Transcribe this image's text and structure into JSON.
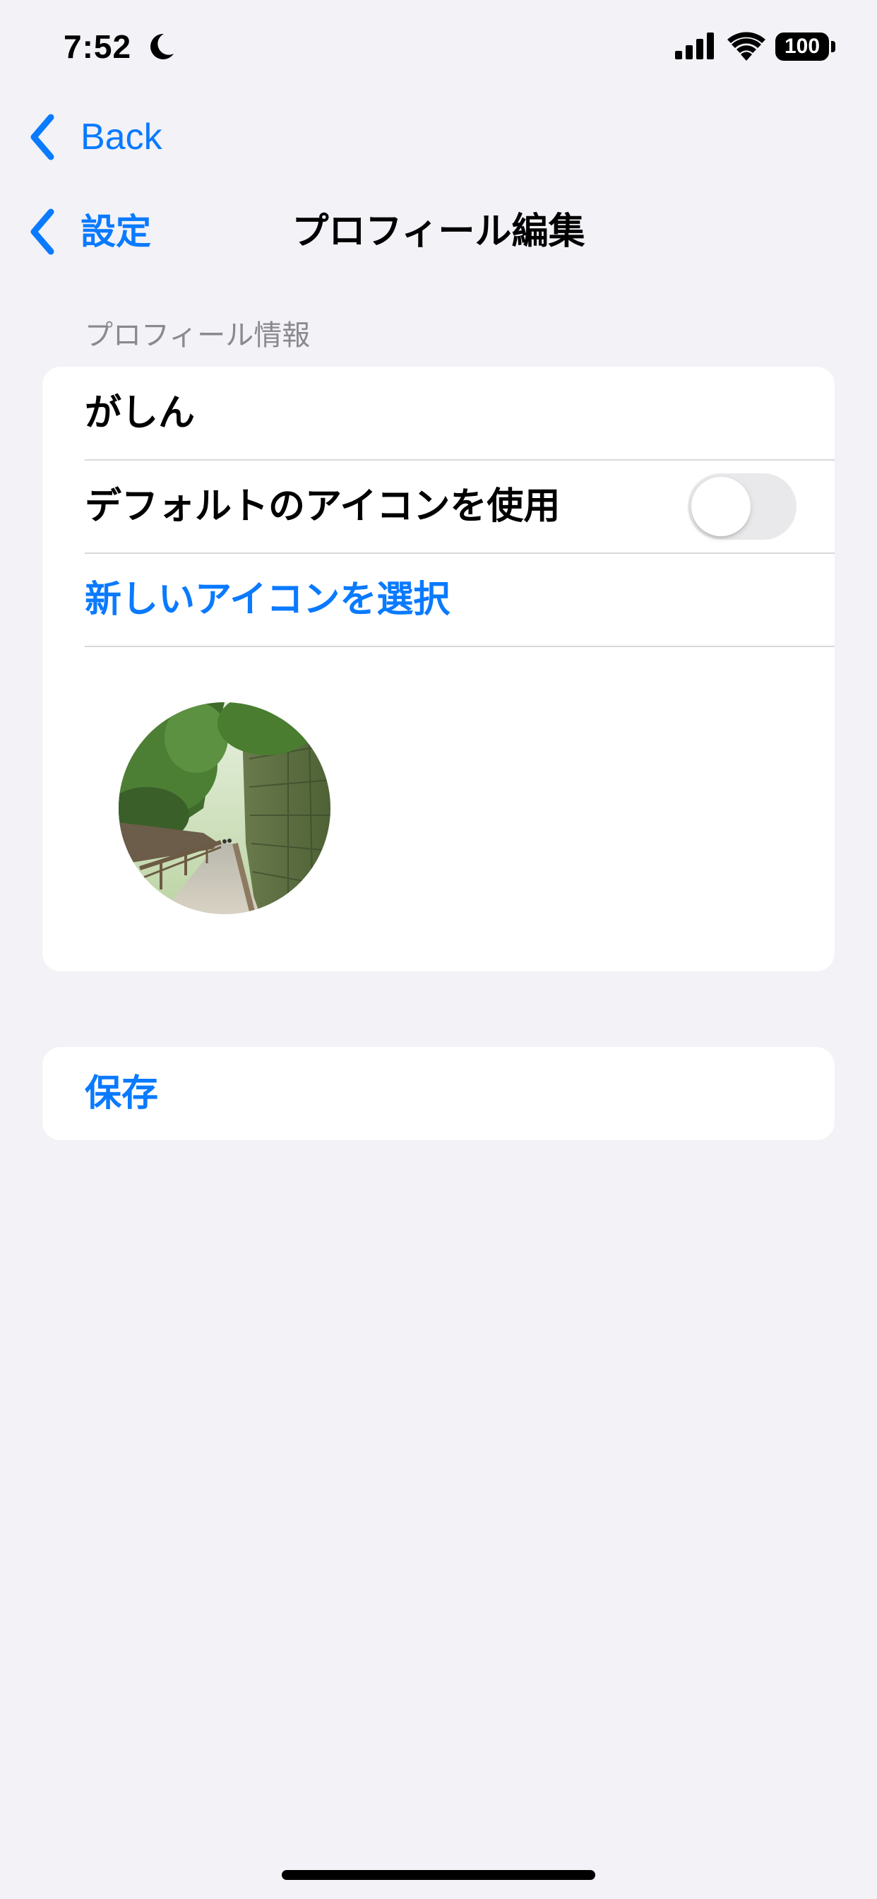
{
  "status_bar": {
    "time": "7:52",
    "battery": "100",
    "icons": [
      "moon-icon",
      "cellular-signal-icon",
      "wifi-icon",
      "battery-icon"
    ]
  },
  "nav": {
    "back_label": "Back",
    "settings_back_label": "設定",
    "title": "プロフィール編集"
  },
  "section": {
    "header": "プロフィール情報",
    "name_value": "がしん",
    "default_icon_label": "デフォルトのアイコンを使用",
    "default_icon_enabled": false,
    "choose_icon_label": "新しいアイコンを選択",
    "avatar_description": "avatar-image"
  },
  "save": {
    "label": "保存"
  },
  "colors": {
    "accent": "#0a7aff",
    "background": "#f2f2f7",
    "card": "#ffffff",
    "secondary_text": "#8a8a8e",
    "toggle_off": "#e9e9eb"
  }
}
